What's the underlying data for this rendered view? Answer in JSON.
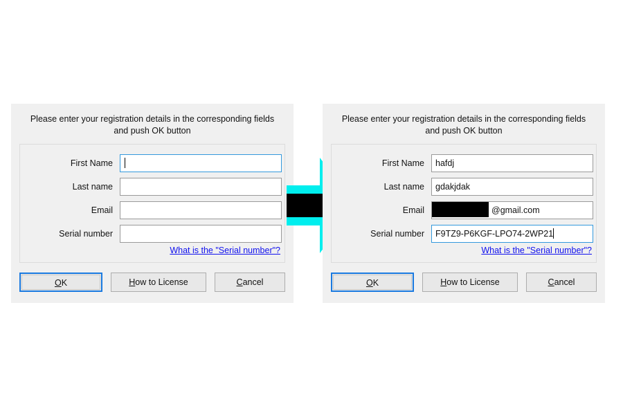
{
  "dialogs": [
    {
      "id": "empty",
      "instruction": "Please enter your registration details in the corresponding fields and push OK button",
      "fields": [
        {
          "label": "First Name",
          "value": "",
          "focused": true,
          "caret": true,
          "redacted": false
        },
        {
          "label": "Last name",
          "value": "",
          "focused": false,
          "caret": false,
          "redacted": false
        },
        {
          "label": "Email",
          "value": "",
          "focused": false,
          "caret": false,
          "redacted": false
        },
        {
          "label": "Serial number",
          "value": "",
          "focused": false,
          "caret": false,
          "redacted": false
        }
      ],
      "help_link": "What is the \"Serial number\"?",
      "buttons": [
        {
          "label": "OK",
          "accel": "O",
          "default": true
        },
        {
          "label": "How to License",
          "accel": "H",
          "default": false
        },
        {
          "label": "Cancel",
          "accel": "C",
          "default": false
        }
      ]
    },
    {
      "id": "filled",
      "instruction": "Please enter your registration details in the corresponding fields and push OK button",
      "fields": [
        {
          "label": "First Name",
          "value": "hafdj",
          "focused": false,
          "caret": false,
          "redacted": false
        },
        {
          "label": "Last name",
          "value": "gdakjdak",
          "focused": false,
          "caret": false,
          "redacted": false
        },
        {
          "label": "Email",
          "value": "@gmail.com",
          "focused": false,
          "caret": false,
          "redacted": true
        },
        {
          "label": "Serial number",
          "value": "F9TZ9-P6KGF-LPO74-2WP21",
          "focused": true,
          "caret": true,
          "redacted": false
        }
      ],
      "help_link": "What is the \"Serial number\"?",
      "buttons": [
        {
          "label": "OK",
          "accel": "O",
          "default": true
        },
        {
          "label": "How to License",
          "accel": "H",
          "default": false
        },
        {
          "label": "Cancel",
          "accel": "C",
          "default": false
        }
      ]
    }
  ],
  "arrow": {
    "name": "right-arrow",
    "outer_color": "#00eeee",
    "inner_color": "#000000"
  },
  "colors": {
    "dialog_background": "#f0f0f0",
    "page_background": "#ffffff",
    "input_background": "#ffffff",
    "input_border": "#9a9a9a",
    "focus_border": "#3399dd",
    "default_button_border": "#1a7ae0",
    "link": "#1010ee",
    "text": "#111111"
  }
}
